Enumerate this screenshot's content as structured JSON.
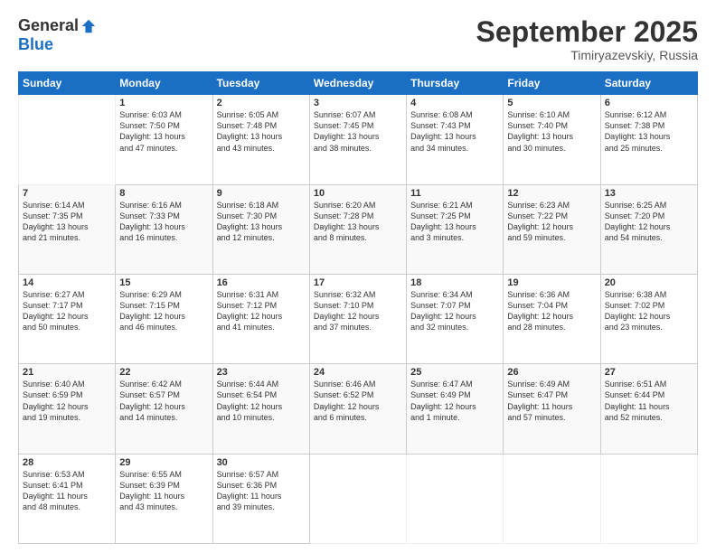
{
  "header": {
    "logo_general": "General",
    "logo_blue": "Blue",
    "month_title": "September 2025",
    "location": "Timiryazevskiy, Russia"
  },
  "days_of_week": [
    "Sunday",
    "Monday",
    "Tuesday",
    "Wednesday",
    "Thursday",
    "Friday",
    "Saturday"
  ],
  "weeks": [
    [
      {
        "day": "",
        "info": ""
      },
      {
        "day": "1",
        "info": "Sunrise: 6:03 AM\nSunset: 7:50 PM\nDaylight: 13 hours\nand 47 minutes."
      },
      {
        "day": "2",
        "info": "Sunrise: 6:05 AM\nSunset: 7:48 PM\nDaylight: 13 hours\nand 43 minutes."
      },
      {
        "day": "3",
        "info": "Sunrise: 6:07 AM\nSunset: 7:45 PM\nDaylight: 13 hours\nand 38 minutes."
      },
      {
        "day": "4",
        "info": "Sunrise: 6:08 AM\nSunset: 7:43 PM\nDaylight: 13 hours\nand 34 minutes."
      },
      {
        "day": "5",
        "info": "Sunrise: 6:10 AM\nSunset: 7:40 PM\nDaylight: 13 hours\nand 30 minutes."
      },
      {
        "day": "6",
        "info": "Sunrise: 6:12 AM\nSunset: 7:38 PM\nDaylight: 13 hours\nand 25 minutes."
      }
    ],
    [
      {
        "day": "7",
        "info": "Sunrise: 6:14 AM\nSunset: 7:35 PM\nDaylight: 13 hours\nand 21 minutes."
      },
      {
        "day": "8",
        "info": "Sunrise: 6:16 AM\nSunset: 7:33 PM\nDaylight: 13 hours\nand 16 minutes."
      },
      {
        "day": "9",
        "info": "Sunrise: 6:18 AM\nSunset: 7:30 PM\nDaylight: 13 hours\nand 12 minutes."
      },
      {
        "day": "10",
        "info": "Sunrise: 6:20 AM\nSunset: 7:28 PM\nDaylight: 13 hours\nand 8 minutes."
      },
      {
        "day": "11",
        "info": "Sunrise: 6:21 AM\nSunset: 7:25 PM\nDaylight: 13 hours\nand 3 minutes."
      },
      {
        "day": "12",
        "info": "Sunrise: 6:23 AM\nSunset: 7:22 PM\nDaylight: 12 hours\nand 59 minutes."
      },
      {
        "day": "13",
        "info": "Sunrise: 6:25 AM\nSunset: 7:20 PM\nDaylight: 12 hours\nand 54 minutes."
      }
    ],
    [
      {
        "day": "14",
        "info": "Sunrise: 6:27 AM\nSunset: 7:17 PM\nDaylight: 12 hours\nand 50 minutes."
      },
      {
        "day": "15",
        "info": "Sunrise: 6:29 AM\nSunset: 7:15 PM\nDaylight: 12 hours\nand 46 minutes."
      },
      {
        "day": "16",
        "info": "Sunrise: 6:31 AM\nSunset: 7:12 PM\nDaylight: 12 hours\nand 41 minutes."
      },
      {
        "day": "17",
        "info": "Sunrise: 6:32 AM\nSunset: 7:10 PM\nDaylight: 12 hours\nand 37 minutes."
      },
      {
        "day": "18",
        "info": "Sunrise: 6:34 AM\nSunset: 7:07 PM\nDaylight: 12 hours\nand 32 minutes."
      },
      {
        "day": "19",
        "info": "Sunrise: 6:36 AM\nSunset: 7:04 PM\nDaylight: 12 hours\nand 28 minutes."
      },
      {
        "day": "20",
        "info": "Sunrise: 6:38 AM\nSunset: 7:02 PM\nDaylight: 12 hours\nand 23 minutes."
      }
    ],
    [
      {
        "day": "21",
        "info": "Sunrise: 6:40 AM\nSunset: 6:59 PM\nDaylight: 12 hours\nand 19 minutes."
      },
      {
        "day": "22",
        "info": "Sunrise: 6:42 AM\nSunset: 6:57 PM\nDaylight: 12 hours\nand 14 minutes."
      },
      {
        "day": "23",
        "info": "Sunrise: 6:44 AM\nSunset: 6:54 PM\nDaylight: 12 hours\nand 10 minutes."
      },
      {
        "day": "24",
        "info": "Sunrise: 6:46 AM\nSunset: 6:52 PM\nDaylight: 12 hours\nand 6 minutes."
      },
      {
        "day": "25",
        "info": "Sunrise: 6:47 AM\nSunset: 6:49 PM\nDaylight: 12 hours\nand 1 minute."
      },
      {
        "day": "26",
        "info": "Sunrise: 6:49 AM\nSunset: 6:47 PM\nDaylight: 11 hours\nand 57 minutes."
      },
      {
        "day": "27",
        "info": "Sunrise: 6:51 AM\nSunset: 6:44 PM\nDaylight: 11 hours\nand 52 minutes."
      }
    ],
    [
      {
        "day": "28",
        "info": "Sunrise: 6:53 AM\nSunset: 6:41 PM\nDaylight: 11 hours\nand 48 minutes."
      },
      {
        "day": "29",
        "info": "Sunrise: 6:55 AM\nSunset: 6:39 PM\nDaylight: 11 hours\nand 43 minutes."
      },
      {
        "day": "30",
        "info": "Sunrise: 6:57 AM\nSunset: 6:36 PM\nDaylight: 11 hours\nand 39 minutes."
      },
      {
        "day": "",
        "info": ""
      },
      {
        "day": "",
        "info": ""
      },
      {
        "day": "",
        "info": ""
      },
      {
        "day": "",
        "info": ""
      }
    ]
  ]
}
